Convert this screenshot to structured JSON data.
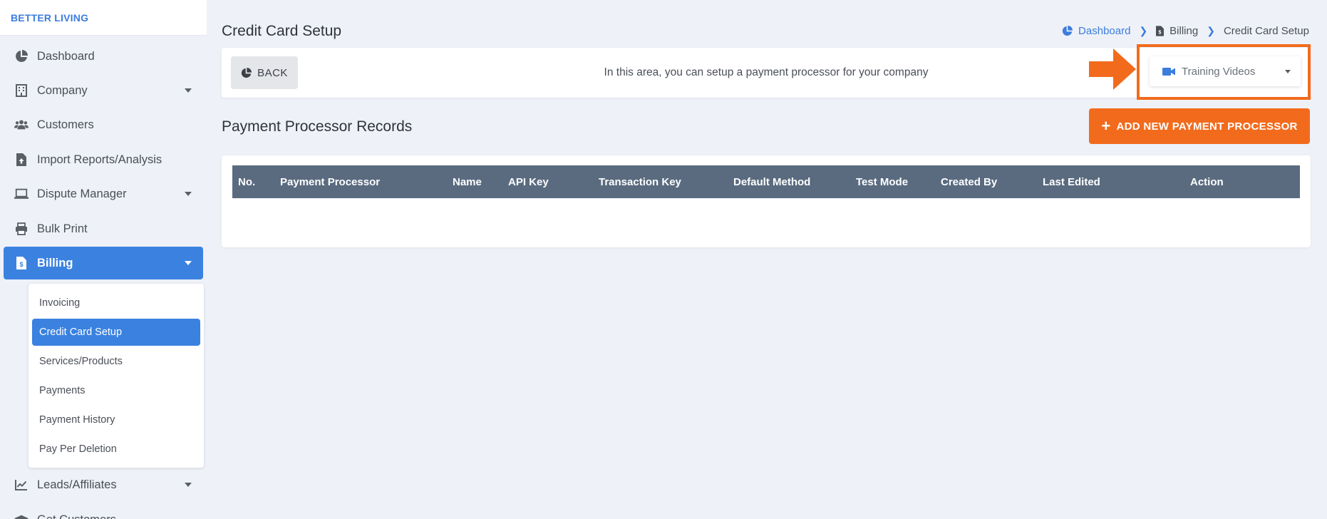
{
  "brand": "BETTER LIVING",
  "sidebar": {
    "items": [
      {
        "label": "Dashboard",
        "icon": "pie-chart-icon"
      },
      {
        "label": "Company",
        "icon": "building-icon",
        "has_caret": true
      },
      {
        "label": "Customers",
        "icon": "users-icon"
      },
      {
        "label": "Import Reports/Analysis",
        "icon": "file-upload-icon"
      },
      {
        "label": "Dispute Manager",
        "icon": "laptop-icon",
        "has_caret": true
      },
      {
        "label": "Bulk Print",
        "icon": "printer-icon"
      },
      {
        "label": "Billing",
        "icon": "invoice-icon",
        "has_caret": true,
        "active": true
      },
      {
        "label": "Leads/Affiliates",
        "icon": "line-chart-icon",
        "has_caret": true
      },
      {
        "label": "Get Customers",
        "icon": "cap-icon"
      }
    ],
    "billing_submenu": [
      {
        "label": "Invoicing"
      },
      {
        "label": "Credit Card Setup",
        "active": true
      },
      {
        "label": "Services/Products"
      },
      {
        "label": "Payments"
      },
      {
        "label": "Payment History"
      },
      {
        "label": "Pay Per Deletion"
      }
    ]
  },
  "header": {
    "title": "Credit Card Setup",
    "breadcrumb": [
      {
        "label": "Dashboard",
        "icon": "pie-chart-icon"
      },
      {
        "label": "Billing",
        "icon": "invoice-icon"
      },
      {
        "label": "Credit Card Setup"
      }
    ]
  },
  "info_bar": {
    "back_label": "BACK",
    "text": "In this area, you can setup a payment processor for your company",
    "training_label": "Training Videos"
  },
  "section": {
    "title": "Payment Processor Records",
    "add_label": "ADD NEW PAYMENT PROCESSOR"
  },
  "table": {
    "columns": [
      "No.",
      "Payment Processor",
      "Name",
      "API Key",
      "Transaction Key",
      "Default Method",
      "Test Mode",
      "Created By",
      "Last Edited",
      "Action"
    ],
    "rows": []
  },
  "colors": {
    "accent": "#3b82e0",
    "orange": "#f26b1d",
    "table_header": "#5a6b80",
    "background": "#eef1f8"
  }
}
